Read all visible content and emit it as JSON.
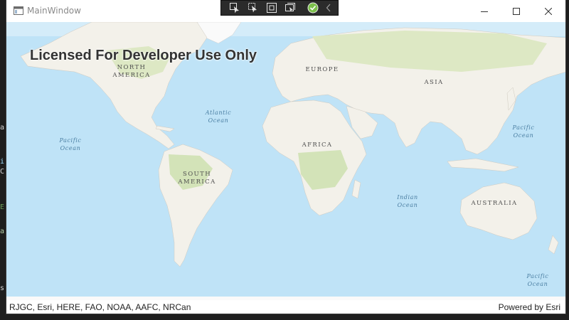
{
  "window": {
    "title": "MainWindow"
  },
  "debug_toolbar": {
    "tools": [
      "select-element-icon",
      "display-layout-adorners-icon",
      "track-focused-element-icon",
      "hot-reload-status-icon",
      "collapse-toolbar-icon"
    ]
  },
  "map": {
    "watermark": "Licensed For Developer Use Only",
    "continent_labels": {
      "north_america_1": "NORTH",
      "north_america_2": "AMERICA",
      "south_america_1": "SOUTH",
      "south_america_2": "AMERICA",
      "europe": "EUROPE",
      "asia": "ASIA",
      "africa": "AFRICA",
      "australia": "AUSTRALIA"
    },
    "ocean_labels": {
      "atlantic_1": "Atlantic",
      "atlantic_2": "Ocean",
      "pacific_west_1": "Pacific",
      "pacific_west_2": "Ocean",
      "pacific_east_1": "Pacific",
      "pacific_east_2": "Ocean",
      "pacific_south_1": "Pacific",
      "pacific_south_2": "Ocean",
      "indian_1": "Indian",
      "indian_2": "Ocean"
    },
    "attribution": "RJGC, Esri, HERE, FAO, NOAA, AAFC, NRCan",
    "powered_by": "Powered by Esri"
  },
  "colors": {
    "ocean": "#bfe3f7",
    "land": "#f3f1ea",
    "vegetation": "#dde8c4",
    "ice": "#fafafa",
    "toolbar_bg": "#2b2b2b",
    "hot_reload_ok": "#7cc04b"
  }
}
